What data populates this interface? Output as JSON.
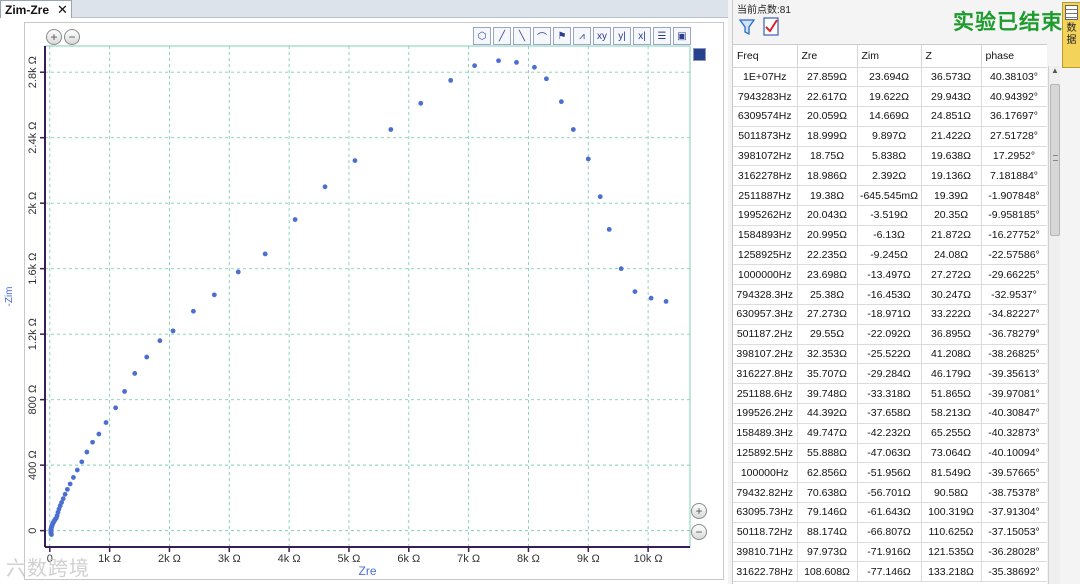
{
  "tab": {
    "title": "Zim-Zre",
    "close": "✕"
  },
  "colors": {
    "point": "#4b6fd0",
    "grid": "#7fcfb5",
    "axis": "#3a1d55",
    "status": "#1d9b2c",
    "axis_label": "#4a6cd8"
  },
  "panel": {
    "point_count": "当前点数:81",
    "status": "实验已结束",
    "data_tab": [
      "数",
      "据"
    ],
    "icons": [
      "filter-icon",
      "checklist-icon",
      "grid-icon"
    ]
  },
  "toolbar_icons": [
    "hexagon-icon",
    "line-icon",
    "diagonal-icon",
    "arc-icon",
    "marker-icon",
    "peak-icon",
    "xy-icon",
    "y-cursor-icon",
    "x-cursor-icon",
    "layers-icon",
    "save-icon"
  ],
  "watermark": "六数跨境",
  "table": {
    "headers": [
      "Freq",
      "Zre",
      "Zim",
      "Z",
      "phase"
    ],
    "rows": [
      [
        "1E+07Hz",
        "27.859Ω",
        "23.694Ω",
        "36.573Ω",
        "40.38103°"
      ],
      [
        "7943283Hz",
        "22.617Ω",
        "19.622Ω",
        "29.943Ω",
        "40.94392°"
      ],
      [
        "6309574Hz",
        "20.059Ω",
        "14.669Ω",
        "24.851Ω",
        "36.17697°"
      ],
      [
        "5011873Hz",
        "18.999Ω",
        "9.897Ω",
        "21.422Ω",
        "27.51728°"
      ],
      [
        "3981072Hz",
        "18.75Ω",
        "5.838Ω",
        "19.638Ω",
        "17.2952°"
      ],
      [
        "3162278Hz",
        "18.986Ω",
        "2.392Ω",
        "19.136Ω",
        "7.181884°"
      ],
      [
        "2511887Hz",
        "19.38Ω",
        "-645.545mΩ",
        "19.39Ω",
        "-1.907848°"
      ],
      [
        "1995262Hz",
        "20.043Ω",
        "-3.519Ω",
        "20.35Ω",
        "-9.958185°"
      ],
      [
        "1584893Hz",
        "20.995Ω",
        "-6.13Ω",
        "21.872Ω",
        "-16.27752°"
      ],
      [
        "1258925Hz",
        "22.235Ω",
        "-9.245Ω",
        "24.08Ω",
        "-22.57586°"
      ],
      [
        "1000000Hz",
        "23.698Ω",
        "-13.497Ω",
        "27.272Ω",
        "-29.66225°"
      ],
      [
        "794328.3Hz",
        "25.38Ω",
        "-16.453Ω",
        "30.247Ω",
        "-32.9537°"
      ],
      [
        "630957.3Hz",
        "27.273Ω",
        "-18.971Ω",
        "33.222Ω",
        "-34.82227°"
      ],
      [
        "501187.2Hz",
        "29.55Ω",
        "-22.092Ω",
        "36.895Ω",
        "-36.78279°"
      ],
      [
        "398107.2Hz",
        "32.353Ω",
        "-25.522Ω",
        "41.208Ω",
        "-38.26825°"
      ],
      [
        "316227.8Hz",
        "35.707Ω",
        "-29.284Ω",
        "46.179Ω",
        "-39.35613°"
      ],
      [
        "251188.6Hz",
        "39.748Ω",
        "-33.318Ω",
        "51.865Ω",
        "-39.97081°"
      ],
      [
        "199526.2Hz",
        "44.392Ω",
        "-37.658Ω",
        "58.213Ω",
        "-40.30847°"
      ],
      [
        "158489.3Hz",
        "49.747Ω",
        "-42.232Ω",
        "65.255Ω",
        "-40.32873°"
      ],
      [
        "125892.5Hz",
        "55.888Ω",
        "-47.063Ω",
        "73.064Ω",
        "-40.10094°"
      ],
      [
        "100000Hz",
        "62.856Ω",
        "-51.956Ω",
        "81.549Ω",
        "-39.57665°"
      ],
      [
        "79432.82Hz",
        "70.638Ω",
        "-56.701Ω",
        "90.58Ω",
        "-38.75378°"
      ],
      [
        "63095.73Hz",
        "79.146Ω",
        "-61.643Ω",
        "100.319Ω",
        "-37.91304°"
      ],
      [
        "50118.72Hz",
        "88.174Ω",
        "-66.807Ω",
        "110.625Ω",
        "-37.15053°"
      ],
      [
        "39810.71Hz",
        "97.973Ω",
        "-71.916Ω",
        "121.535Ω",
        "-36.28028°"
      ],
      [
        "31622.78Hz",
        "108.608Ω",
        "-77.146Ω",
        "133.218Ω",
        "-35.38692°"
      ]
    ]
  },
  "chart_data": {
    "type": "scatter",
    "xlabel": "Zre",
    "ylabel": "-Zim",
    "xlim": [
      -80,
      10700
    ],
    "ylim": [
      -100,
      2960
    ],
    "x_ticks": [
      0,
      1000,
      2000,
      3000,
      4000,
      5000,
      6000,
      7000,
      8000,
      9000,
      10000
    ],
    "x_tick_labels": [
      "0",
      "1k Ω",
      "2k Ω",
      "3k Ω",
      "4k Ω",
      "5k Ω",
      "6k Ω",
      "7k Ω",
      "8k Ω",
      "9k Ω",
      "10k Ω"
    ],
    "y_ticks": [
      0,
      400,
      800,
      1200,
      1600,
      2000,
      2400,
      2800
    ],
    "y_tick_labels": [
      "0",
      "400 Ω",
      "800 Ω",
      "1.2k Ω",
      "1.6k Ω",
      "2k Ω",
      "2.4k Ω",
      "2.8k Ω"
    ],
    "grid": true,
    "x": [
      28,
      23,
      20,
      19,
      19,
      19,
      19,
      20,
      21,
      22,
      24,
      25,
      27,
      30,
      32,
      36,
      40,
      44,
      50,
      56,
      63,
      71,
      79,
      88,
      98,
      109,
      122,
      137,
      154,
      174,
      197,
      224,
      256,
      294,
      340,
      395,
      460,
      535,
      620,
      715,
      820,
      940,
      1100,
      1250,
      1420,
      1620,
      1840,
      2060,
      2400,
      2750,
      3150,
      3600,
      4100,
      4600,
      5100,
      5700,
      6200,
      6700,
      7100,
      7500,
      7800,
      8100,
      8300,
      8550,
      8750,
      9000,
      9200,
      9350,
      9550,
      9780,
      10050,
      10300
    ],
    "y": [
      -24,
      -20,
      -15,
      -10,
      -6,
      -2,
      1,
      4,
      6,
      9,
      13,
      16,
      19,
      22,
      26,
      29,
      33,
      38,
      42,
      47,
      52,
      57,
      62,
      67,
      72,
      77,
      92,
      112,
      132,
      152,
      172,
      195,
      222,
      252,
      285,
      325,
      370,
      420,
      480,
      540,
      590,
      660,
      750,
      850,
      960,
      1060,
      1160,
      1220,
      1340,
      1440,
      1580,
      1690,
      1900,
      2100,
      2260,
      2450,
      2610,
      2750,
      2840,
      2870,
      2860,
      2830,
      2760,
      2620,
      2450,
      2270,
      2040,
      1840,
      1600,
      1460,
      1420,
      1400,
      1440,
      1500,
      1620,
      1780
    ]
  }
}
